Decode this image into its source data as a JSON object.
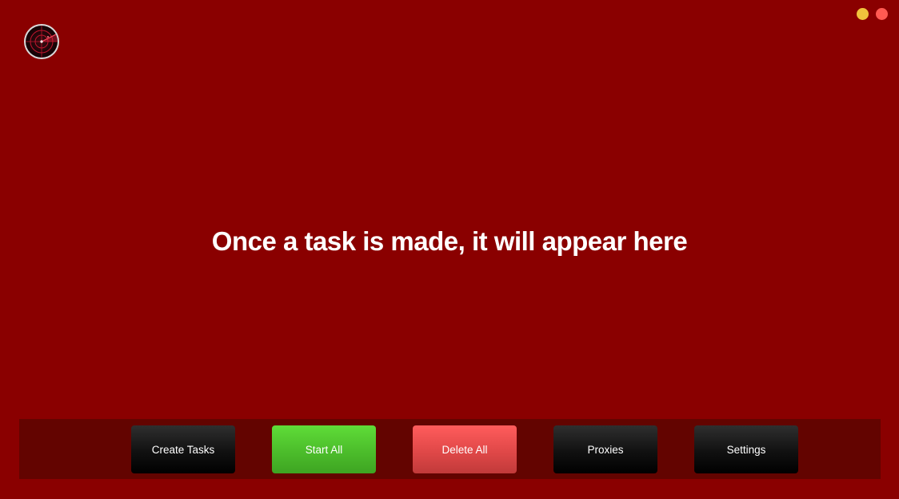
{
  "window": {
    "minimize_color": "#f0c33c",
    "close_color": "#ff5a52"
  },
  "logo": {
    "icon": "radar-icon"
  },
  "main": {
    "empty_message": "Once a task is made, it will appear here"
  },
  "toolbar": {
    "create_tasks_label": "Create Tasks",
    "start_all_label": "Start All",
    "delete_all_label": "Delete All",
    "proxies_label": "Proxies",
    "settings_label": "Settings"
  },
  "colors": {
    "background": "#8a0000",
    "toolbar_background": "#630400",
    "start_accent": "#4cbd2b",
    "delete_accent": "#e04848",
    "dark_button": "#111111"
  }
}
